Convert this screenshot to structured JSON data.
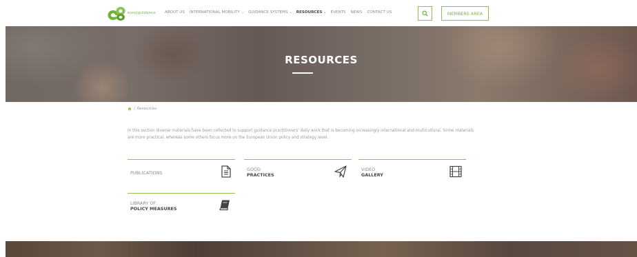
{
  "header": {
    "logo_text": "euro|guidance",
    "nav": [
      {
        "label": "ABOUT US",
        "dropdown": false,
        "active": false
      },
      {
        "label": "INTERNATIONAL MOBILITY",
        "dropdown": true,
        "active": false
      },
      {
        "label": "GUIDANCE SYSTEMS",
        "dropdown": true,
        "active": false
      },
      {
        "label": "RESOURCES",
        "dropdown": true,
        "active": true
      },
      {
        "label": "EVENTS",
        "dropdown": false,
        "active": false
      },
      {
        "label": "NEWS",
        "dropdown": false,
        "active": false
      },
      {
        "label": "CONTACT US",
        "dropdown": false,
        "active": false
      }
    ],
    "members_label": "MEMBERS AREA"
  },
  "hero": {
    "title": "RESOURCES"
  },
  "breadcrumb": {
    "current": "Resources"
  },
  "intro": "In this section diverse materials have been collected to support guidance practitioners' daily work that is becoming increasingly international and multicultural. Some materials are more practical, whereas some others focus more on the European Union policy and strategy level.",
  "cards": {
    "publications": {
      "line1": "PUBLICATIONS",
      "line2": ""
    },
    "good_practices": {
      "line1": "GOOD",
      "line2": "PRACTICES"
    },
    "video_gallery": {
      "line1": "VIDEO",
      "line2": "GALLERY"
    },
    "policy_library": {
      "line1": "LIBRARY OF",
      "line2": "POLICY MEASURES"
    }
  },
  "icons": {
    "search": "search-icon",
    "home": "home-icon",
    "publications": "document-icon",
    "good_practices": "paper-plane-icon",
    "video_gallery": "film-icon",
    "policy_library": "book-icon"
  },
  "colors": {
    "accent": "#8cc152",
    "text": "#6d6d6d"
  }
}
